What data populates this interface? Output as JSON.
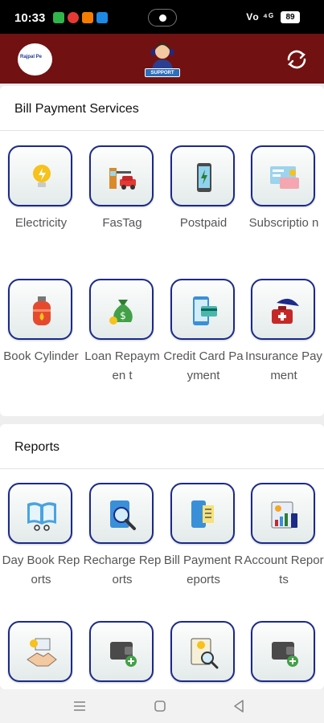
{
  "status_bar": {
    "time": "10:33",
    "battery": "89",
    "signal_text": "Vo ⁴ᴳ"
  },
  "header": {
    "logo_text": "Rajpal Pe",
    "support_label": "SUPPORT"
  },
  "bill_payment": {
    "title": "Bill Payment Services",
    "items": [
      {
        "label": "Electricity",
        "icon": "bulb-icon"
      },
      {
        "label": "FasTag",
        "icon": "toll-car-icon"
      },
      {
        "label": "Postpaid",
        "icon": "phone-icon"
      },
      {
        "label": "Subscriptio n",
        "icon": "subscription-icon"
      },
      {
        "label": "Book Cylinder",
        "icon": "gas-cylinder-icon"
      },
      {
        "label": "Loan Repaymen t",
        "icon": "money-bag-icon"
      },
      {
        "label": "Credit Card Payment",
        "icon": "credit-card-icon"
      },
      {
        "label": "Insurance Payment",
        "icon": "umbrella-icon"
      }
    ]
  },
  "reports": {
    "title": "Reports",
    "items": [
      {
        "label": "Day Book Reports",
        "icon": "book-icon"
      },
      {
        "label": "Recharge Reports",
        "icon": "search-report-icon"
      },
      {
        "label": "Bill Payment Reports",
        "icon": "bill-phone-icon"
      },
      {
        "label": "Account Reports",
        "icon": "account-report-icon"
      },
      {
        "label": "",
        "icon": "handshake-icon"
      },
      {
        "label": "",
        "icon": "wallet-add-icon"
      },
      {
        "label": "",
        "icon": "info-search-icon"
      },
      {
        "label": "",
        "icon": "wallet-add-icon"
      }
    ]
  },
  "colors": {
    "header": "#721111",
    "tile_border": "#1c2a8a"
  }
}
